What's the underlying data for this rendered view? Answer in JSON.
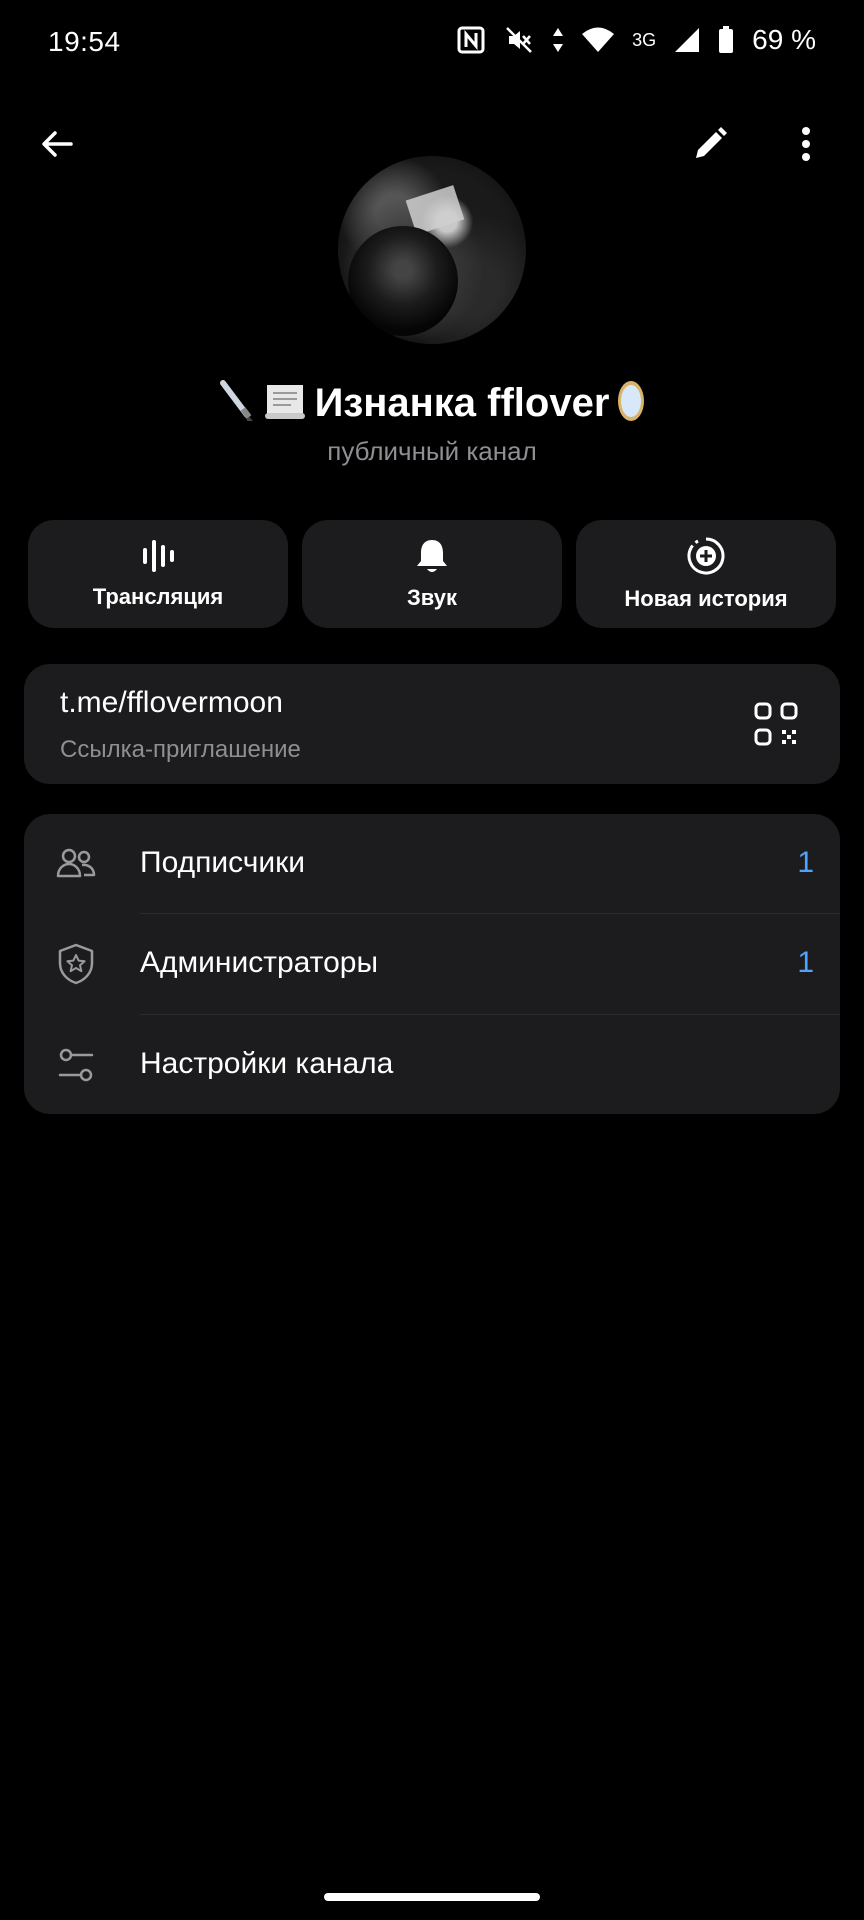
{
  "status_bar": {
    "time": "19:54",
    "network": "3G",
    "battery": "69 %",
    "icons": [
      "nfc-icon",
      "mute-icon",
      "data-arrows-icon",
      "wifi-icon",
      "signal-icon",
      "battery-icon"
    ]
  },
  "top_bar": {
    "icons": [
      "back-arrow-icon",
      "pencil-icon",
      "more-vert-icon"
    ]
  },
  "channel": {
    "title": "Изнанка fflover",
    "subtitle": "публичный канал",
    "emoji_prefix": [
      "pen-emoji",
      "scroll-emoji"
    ],
    "emoji_suffix": "mirror-emoji"
  },
  "actions": [
    {
      "label": "Трансляция",
      "icon": "live-stream-icon"
    },
    {
      "label": "Звук",
      "icon": "bell-icon"
    },
    {
      "label": "Новая история",
      "icon": "story-add-icon"
    }
  ],
  "link": {
    "url": "t.me/fflovermoon",
    "caption": "Ссылка-приглашение",
    "icon": "qr-code-icon"
  },
  "menu": [
    {
      "label": "Подписчики",
      "value": "1",
      "icon": "people-icon"
    },
    {
      "label": "Администраторы",
      "value": "1",
      "icon": "admin-shield-icon"
    },
    {
      "label": "Настройки канала",
      "value": "",
      "icon": "settings-sliders-icon"
    }
  ],
  "colors": {
    "background": "#000000",
    "card": "#1c1c1e",
    "accent": "#4da3ff",
    "secondary_text": "#8e8e93"
  }
}
